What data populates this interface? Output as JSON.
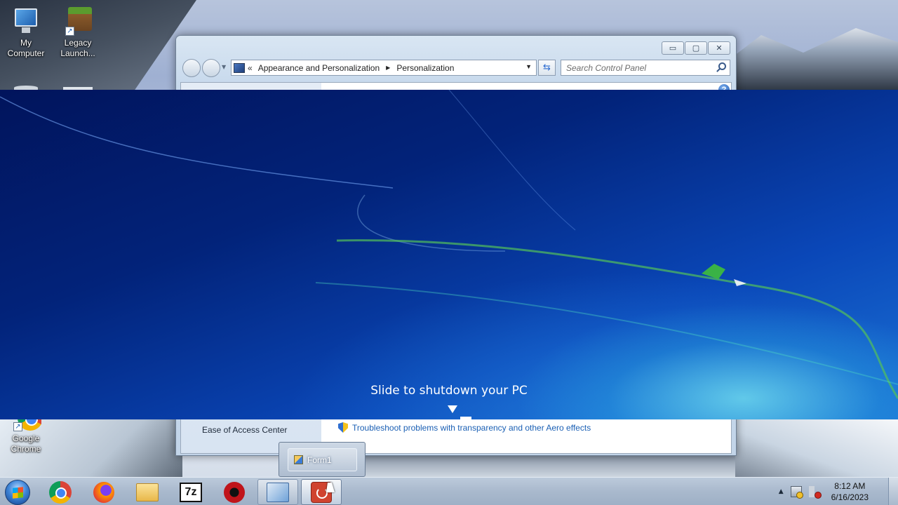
{
  "desktop": {
    "icons": [
      {
        "label": "My\nComputer",
        "icon": "computer-icon"
      },
      {
        "label": "Legacy\nLaunch...",
        "icon": "minecraft-launcher-icon"
      },
      {
        "label": "Google\nChrome",
        "icon": "chrome-icon"
      }
    ]
  },
  "control_panel": {
    "breadcrumb": {
      "overflow": "«",
      "items": [
        "Appearance and Personalization",
        "Personalization"
      ]
    },
    "search_placeholder": "Search Control Panel",
    "window_buttons": {
      "minimize": "▭",
      "maximize": "▢",
      "close": "✕"
    },
    "left_links": [
      "Ease of Access Center"
    ],
    "main_links": [
      "Troubleshoot problems with transparency and other Aero effects"
    ],
    "help": "?"
  },
  "shutdown_overlay": {
    "text": "Slide to shutdown your PC"
  },
  "thumbnail_popup": {
    "items": [
      "Form1"
    ]
  },
  "taskbar": {
    "apps": [
      {
        "name": "Google Chrome",
        "icon": "chrome-icon"
      },
      {
        "name": "Firefox",
        "icon": "firefox-icon"
      },
      {
        "name": "File Explorer",
        "icon": "folder-icon"
      },
      {
        "name": "7-Zip",
        "icon": "7zip-icon",
        "glyph": "7z"
      },
      {
        "name": "Gear app",
        "icon": "red-gear-icon"
      },
      {
        "name": "Control Panel",
        "icon": "control-panel-icon"
      },
      {
        "name": "Form1",
        "icon": "power-icon"
      }
    ],
    "tray": {
      "up_arrow": "▲"
    },
    "clock": {
      "time": "8:12 AM",
      "date": "6/16/2023"
    }
  }
}
